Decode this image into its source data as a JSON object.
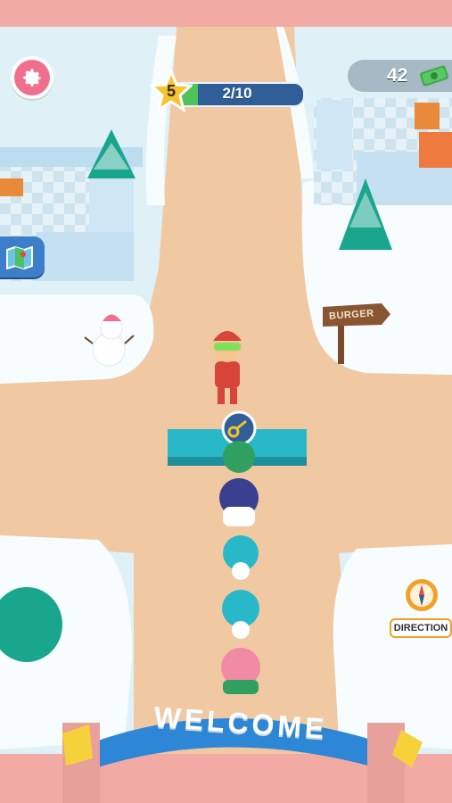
{
  "hud": {
    "level": "5",
    "progress_text": "2/10",
    "progress_fraction": 0.2,
    "cash": "42"
  },
  "buttons": {
    "direction_label": "DIRECTION"
  },
  "world": {
    "sign_label": "BURGER",
    "arch_text": "WELCOME"
  },
  "icons": {
    "settings": "gear-icon",
    "map": "map-icon",
    "direction": "compass-icon",
    "key": "key-icon",
    "cash": "cash-icon",
    "star": "star-icon"
  },
  "colors": {
    "road": "#f0c9a3",
    "snow": "#f5fbfd",
    "ice_wall": "#cfe6f4",
    "counter": "#29b8c8",
    "accent_pink": "#f06f8e",
    "progress_fill": "#4fc25a"
  }
}
